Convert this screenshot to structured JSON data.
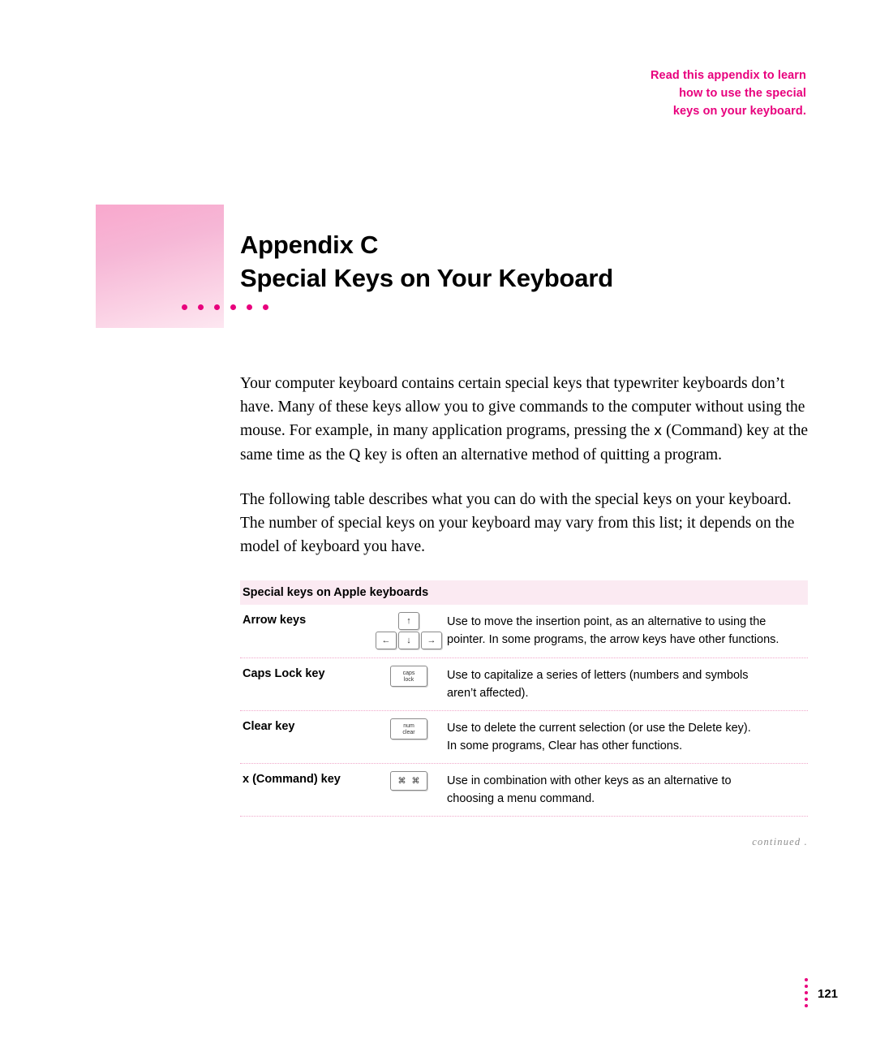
{
  "margin_note": {
    "line1": "Read this appendix to learn",
    "line2": "how to use the special",
    "line3": "keys on your keyboard."
  },
  "title": {
    "line1": "Appendix C",
    "line2": "Special Keys on Your Keyboard"
  },
  "body": {
    "paragraph1": "Your computer keyboard contains certain special keys that typewriter keyboards don’t have. Many of these keys allow you to give commands to the computer without using the mouse. For example, in many application programs, pressing the ",
    "paragraph1_cmd": "x",
    "paragraph1_cont": " (Command) key at the same time as the Q key is often an alternative method of quitting a program.",
    "paragraph2": "The following table describes what you can do with the special keys on your keyboard. The number of special keys on your keyboard may vary from this list; it depends on the model of keyboard you have."
  },
  "table": {
    "header": "Special keys on Apple keyboards",
    "rows": [
      {
        "name": "Arrow keys",
        "key_type": "arrow-cluster",
        "key_labels": {
          "up": "↑",
          "left": "←",
          "down": "↓",
          "right": "→"
        },
        "desc_line1": "Use to move the insertion point, as an alternative to using the",
        "desc_line2": "pointer. In some programs, the arrow keys have other functions."
      },
      {
        "name": "Caps Lock key",
        "key_type": "wide",
        "key_labels": {
          "l1": "caps",
          "l2": "lock"
        },
        "desc_line1": "Use to capitalize a series of letters (numbers and symbols",
        "desc_line2": "aren’t affected)."
      },
      {
        "name": "Clear key",
        "key_type": "wide",
        "key_labels": {
          "l1": "num",
          "l2": "clear"
        },
        "desc_line1": "Use to delete the current selection (or use  the Delete key).",
        "desc_line2": "In some programs, Clear has other functions."
      },
      {
        "name": "x  (Command) key",
        "key_type": "command",
        "key_labels": {
          "l1": "⌘",
          "l2": "⌘"
        },
        "desc_line1": "Use in combination with other keys as an alternative to",
        "desc_line2": "choosing a menu command."
      }
    ]
  },
  "continued": "continued  .",
  "page_number": "121",
  "colors": {
    "accent": "#e8007d",
    "table_header_bg": "#fbeaf2",
    "rule": "#f0a7ca"
  }
}
